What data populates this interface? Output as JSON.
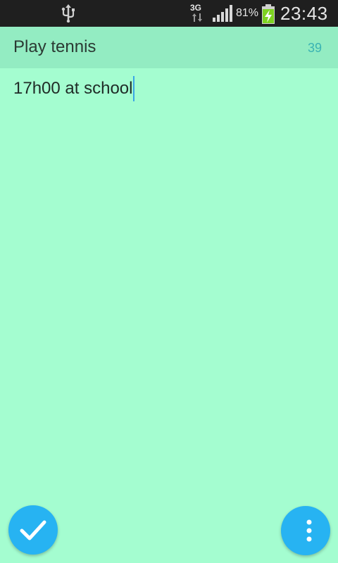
{
  "status_bar": {
    "network_type": "3G",
    "battery_percent": "81%",
    "time": "23:43",
    "icons": [
      "usb-icon",
      "network-arrows-icon",
      "signal-icon",
      "battery-charging-icon"
    ]
  },
  "note": {
    "title": "Play tennis",
    "char_count": "39",
    "body": "17h00 at school"
  },
  "actions": {
    "confirm_icon": "check-icon",
    "more_icon": "more-vertical-icon"
  },
  "colors": {
    "background": "#a4fdd0",
    "title_bar": "#93ecc2",
    "accent": "#27b3f2",
    "count_text": "#3ab3b3",
    "status_bar": "#1f1f1f"
  }
}
